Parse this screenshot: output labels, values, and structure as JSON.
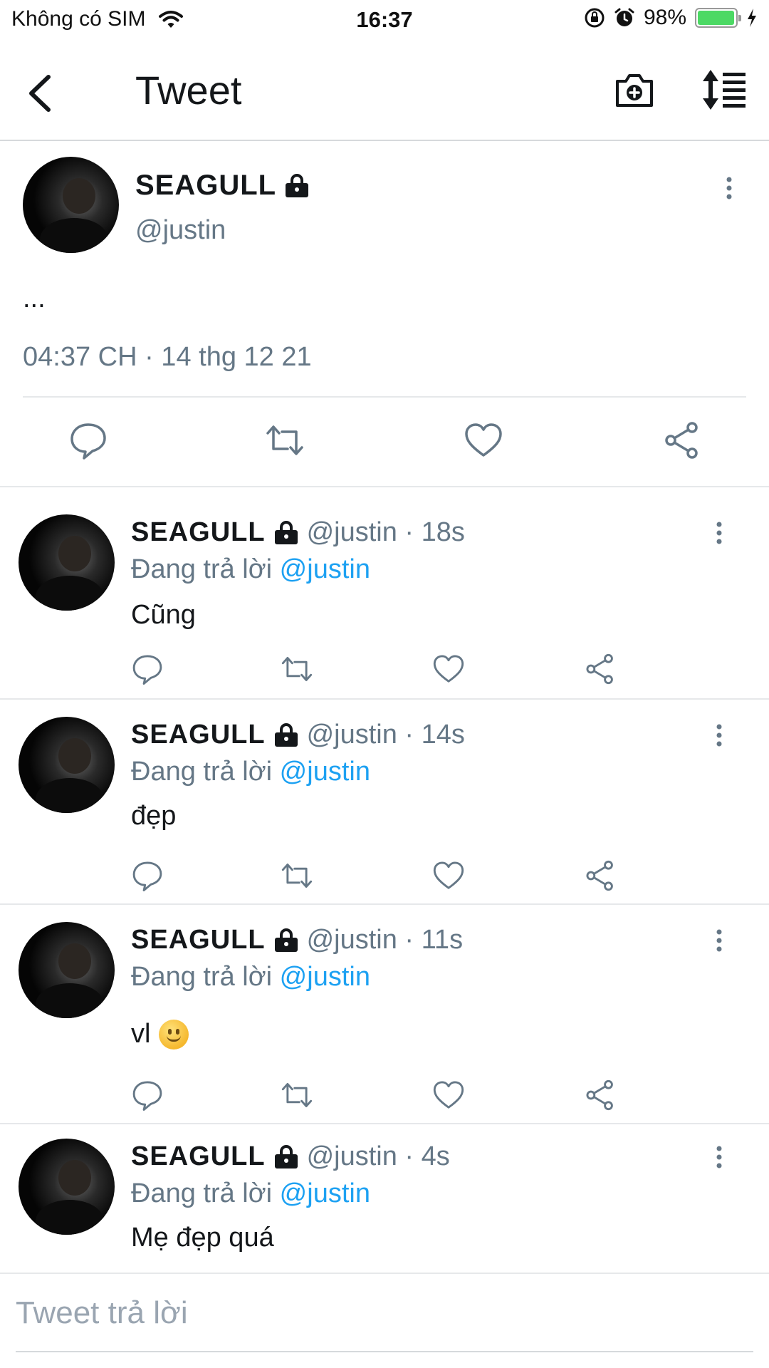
{
  "status_bar": {
    "carrier": "Không có SIM",
    "time": "16:37",
    "battery": "98%",
    "battery_level": 0.98
  },
  "nav": {
    "title": "Tweet",
    "icons": [
      "back-arrow-icon",
      "camera-plus-icon",
      "sort-icon"
    ]
  },
  "tweet": {
    "name": "SEAGULL",
    "handle": "@justin",
    "text": "...",
    "timestamp": "04:37 CH · 14 thg 12 21"
  },
  "replies": [
    {
      "name": "SEAGULL",
      "meta": "@justin · 18s",
      "replying_label": "Đang trả lời",
      "mention": "@justin",
      "text": "Cũng",
      "emoji": ""
    },
    {
      "name": "SEAGULL",
      "meta": "@justin · 14s",
      "replying_label": "Đang trả lời",
      "mention": "@justin",
      "text": "đẹp",
      "emoji": ""
    },
    {
      "name": "SEAGULL",
      "meta": "@justin · 11s",
      "replying_label": "Đang trả lời",
      "mention": "@justin",
      "text": "vl",
      "emoji": "slightly-smiling-face"
    },
    {
      "name": "SEAGULL",
      "meta": "@justin · 4s",
      "replying_label": "Đang trả lời",
      "mention": "@justin",
      "text": "Mẹ đẹp quá",
      "emoji": ""
    }
  ],
  "reply_box": {
    "placeholder": "Tweet trả lời"
  },
  "colors": {
    "mention": "#1da1f2",
    "secondary_text": "#657786",
    "icon": "#657786"
  }
}
